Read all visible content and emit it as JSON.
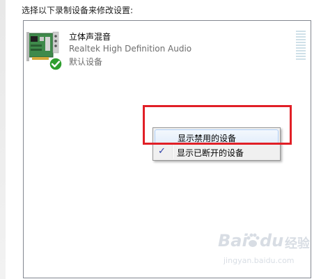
{
  "instruction": "选择以下录制设备来修改设置:",
  "device": {
    "name": "立体声混音",
    "driver": "Realtek High Definition Audio",
    "status": "默认设备",
    "icon": "sound-card-icon",
    "status_icon": "checkmark-icon",
    "default_color": "#2e9e2e"
  },
  "level_meter": {
    "level": 0
  },
  "context_menu": {
    "items": [
      {
        "label": "显示禁用的设备",
        "checked": false,
        "hovered": true
      },
      {
        "label": "显示已断开的设备",
        "checked": true,
        "hovered": false
      }
    ],
    "check_glyph": "✓"
  },
  "annotation": {
    "color": "#e11f26"
  },
  "watermark": {
    "brand_left": "Bai",
    "brand_right": "du",
    "brand_suffix": "经验",
    "url": "jingyan.baidu.com"
  }
}
